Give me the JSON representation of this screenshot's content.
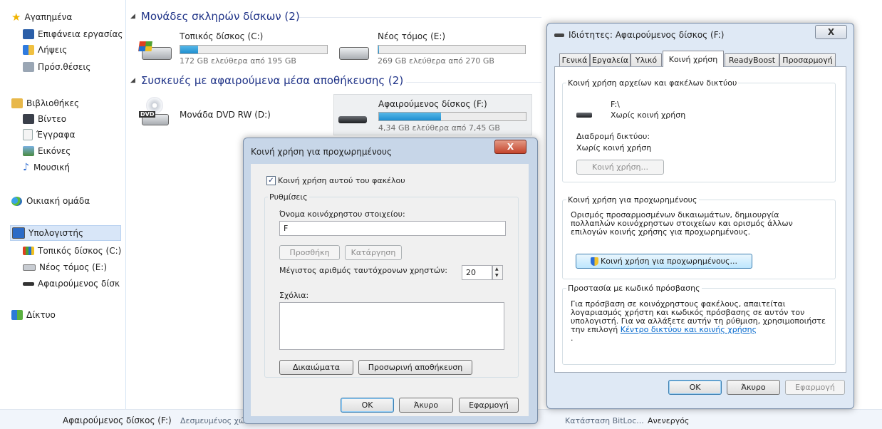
{
  "nav": {
    "favorites": "Αγαπημένα",
    "desktop": "Επιφάνεια εργασίας",
    "downloads": "Λήψεις",
    "recent": "Πρόσ.θέσεις",
    "libraries": "Βιβλιοθήκες",
    "videos": "Βίντεο",
    "documents": "Έγγραφα",
    "pictures": "Εικόνες",
    "music": "Μουσική",
    "homegroup": "Οικιακή ομάδα",
    "computer": "Υπολογιστής",
    "local_disk": "Τοπικός δίσκος (C:)",
    "new_volume": "Νέος τόμος (E:)",
    "removable": "Αφαιρούμενος δίσκ",
    "network": "Δίκτυο"
  },
  "groups": {
    "hdd": "Μονάδες σκληρών δίσκων (2)",
    "removable": "Συσκευές με αφαιρούμενα μέσα αποθήκευσης (2)"
  },
  "drives": [
    {
      "name": "Τοπικός δίσκος (C:)",
      "free": "172 GB ελεύθερα από 195 GB",
      "used_fraction": 0.12
    },
    {
      "name": "Νέος τόμος (E:)",
      "free": "269 GB ελεύθερα από 270 GB",
      "used_fraction": 0.004
    },
    {
      "name": "Μονάδα DVD RW (D:)"
    },
    {
      "name": "Αφαιρούμενος δίσκος (F:)",
      "free": "4,34 GB ελεύθερα από 7,45 GB",
      "used_fraction": 0.42
    }
  ],
  "dvd_label": "DVD",
  "status": {
    "name": "Αφαιρούμενος δίσκος (F:)",
    "used_label": "Δεσμευμένος χώ",
    "bitlocker": "Κατάσταση BitLoc...",
    "bitlocker_value": "Ανενεργός"
  },
  "props": {
    "title": "Ιδιότητες: Αφαιρούμενος δίσκος (F:)",
    "close": "X",
    "tabs": [
      "Γενικά",
      "Εργαλεία",
      "Υλικό",
      "Κοινή χρήση",
      "ReadyBoost",
      "Προσαρμογή"
    ],
    "net_share_legend": "Κοινή χρήση αρχείων και φακέλων δικτύου",
    "path": "F:\\",
    "not_shared": "Χωρίς κοινή χρήση",
    "net_path_label": "Διαδρομή δικτύου:",
    "net_path_value": "Χωρίς κοινή χρήση",
    "share_button": "Κοινή χρήση...",
    "adv_legend": "Κοινή χρήση για προχωρημένους",
    "adv_text": "Ορισμός προσαρμοσμένων δικαιωμάτων, δημιουργία πολλαπλών κοινόχρηστων στοιχείων και ορισμός άλλων επιλογών κοινής χρήσης για προχωρημένους.",
    "adv_button": "Κοινή χρήση για προχωρημένους...",
    "pw_legend": "Προστασία με κωδικό πρόσβασης",
    "pw_text": "Για πρόσβαση σε κοινόχρηστους φακέλους, απαιτείται λογαριασμός χρήστη και κωδικός πρόσβασης σε αυτόν τον υπολογιστή. Για να αλλάξετε αυτήν τη ρύθμιση, χρησιμοποιήστε την επιλογή ",
    "pw_link": "Κέντρο δικτύου και κοινής χρήσης",
    "pw_end": ".",
    "ok": "OK",
    "cancel": "Άκυρο",
    "apply": "Εφαρμογή"
  },
  "adv": {
    "title": "Κοινή χρήση για προχωρημένους",
    "close": "X",
    "share_checkbox": "Κοινή χρήση αυτού του φακέλου",
    "settings_legend": "Ρυθμίσεις",
    "share_name_label": "Όνομα κοινόχρηστου στοιχείου:",
    "share_name_value": "F",
    "add_button": "Προσθήκη",
    "remove_button": "Κατάργηση",
    "max_users_label": "Μέγιστος αριθμός ταυτόχρονων χρηστών:",
    "max_users_value": "20",
    "comments_label": "Σχόλια:",
    "permissions_button": "Δικαιώματα",
    "caching_button": "Προσωρινή αποθήκευση",
    "ok": "OK",
    "cancel": "Άκυρο",
    "apply": "Εφαρμογή"
  }
}
